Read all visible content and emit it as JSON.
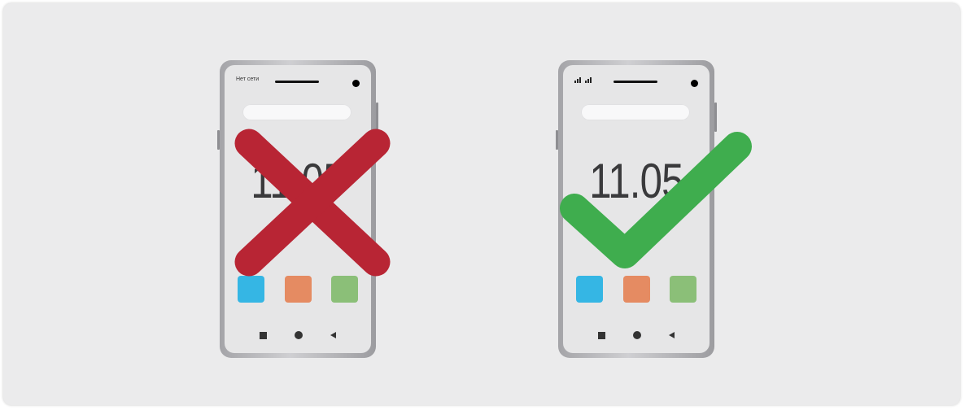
{
  "left_phone": {
    "status_text": "Нет сети",
    "clock": "11:05",
    "apps": [
      {
        "color": "#35b6e4"
      },
      {
        "color": "#e58b62"
      },
      {
        "color": "#8bbf78"
      }
    ],
    "overlay_icon": "cross-icon",
    "overlay_color": "#b82534"
  },
  "right_phone": {
    "status_icons": "signal-bars-icon",
    "clock": "11.05",
    "apps": [
      {
        "color": "#35b6e4"
      },
      {
        "color": "#e58b62"
      },
      {
        "color": "#8bbf78"
      }
    ],
    "overlay_icon": "checkmark-icon",
    "overlay_color": "#3fad4e"
  }
}
